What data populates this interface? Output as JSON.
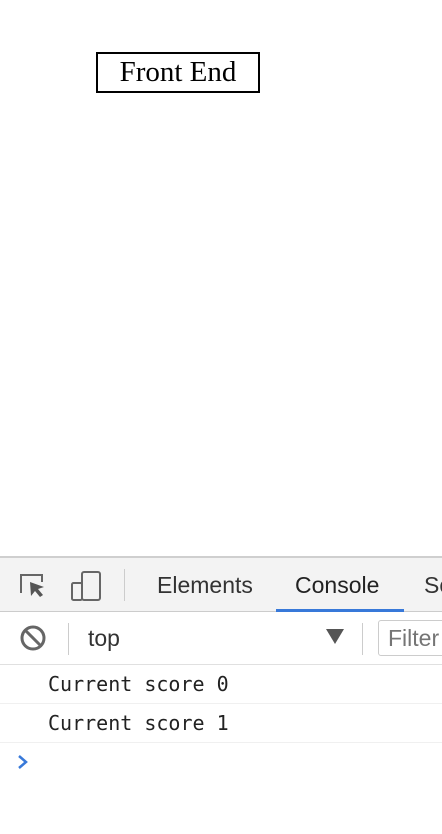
{
  "page": {
    "button_label": "Front End"
  },
  "devtools": {
    "toolbar_icons": [
      "inspect-element-icon",
      "device-toolbar-icon"
    ],
    "tabs": [
      {
        "label": "Elements",
        "active": false
      },
      {
        "label": "Console",
        "active": true
      },
      {
        "label": "So",
        "active": false
      }
    ],
    "console_toolbar": {
      "clear_icon": "clear-console-icon",
      "context": "top",
      "filter_placeholder": "Filter"
    },
    "messages": [
      {
        "text": "Current score 0"
      },
      {
        "text": "Current score 1"
      }
    ],
    "prompt_icon": "prompt-chevron-icon",
    "colors": {
      "active_tab_underline": "#3879d9",
      "prompt": "#3879d9",
      "tabbar_background": "#f3f3f3"
    }
  }
}
